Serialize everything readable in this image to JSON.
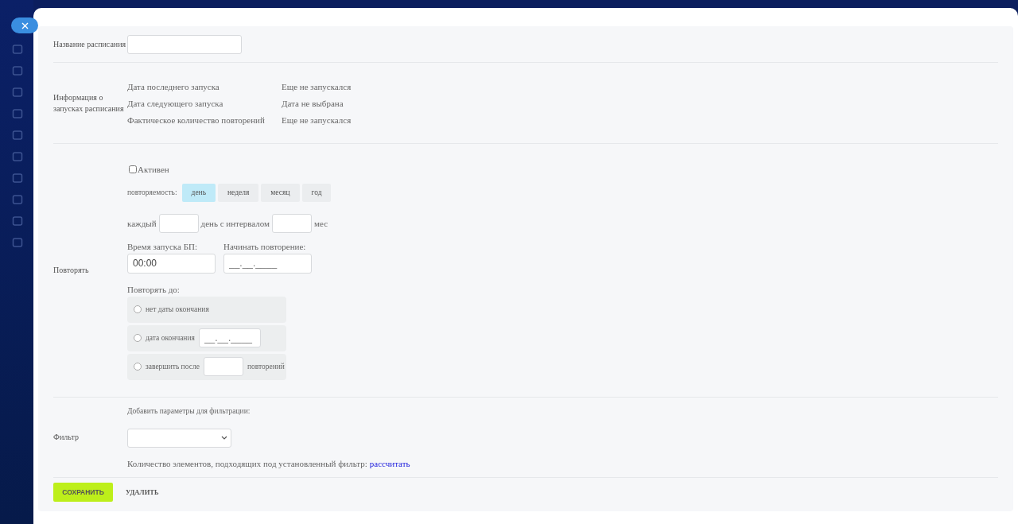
{
  "schedule_name": {
    "label": "Название расписания"
  },
  "run_info": {
    "label": "Информация о запусках расписания",
    "rows": [
      {
        "name": "Дата последнего запуска",
        "value": "Еще не запускался"
      },
      {
        "name": "Дата следующего запуска",
        "value": "Дата не выбрана"
      },
      {
        "name": "Фактическое количество повторений",
        "value": "Еще не запускался"
      }
    ]
  },
  "repeat": {
    "label": "Повторять",
    "active": {
      "label": "Активен",
      "checked": false
    },
    "frequency": {
      "label": "повторяемость:",
      "options": [
        {
          "label": "день",
          "selected": true
        },
        {
          "label": "неделя",
          "selected": false
        },
        {
          "label": "месяц",
          "selected": false
        },
        {
          "label": "год",
          "selected": false
        }
      ]
    },
    "every": {
      "prefix": "каждый",
      "middle": "день с интервалом",
      "suffix": "мес"
    },
    "start_time": {
      "label": "Время запуска БП:",
      "value": "00:00"
    },
    "start_repeat": {
      "label": "Начинать повторение:",
      "placeholder": "__.__.____"
    },
    "until": {
      "label": "Повторять до:",
      "options": [
        {
          "kind": "plain",
          "label": "нет даты окончания",
          "selected": false
        },
        {
          "kind": "date",
          "label": "дата окончания",
          "placeholder": "__.__.____",
          "selected": false
        },
        {
          "kind": "count",
          "label": "завершить после",
          "suffix": "повторений",
          "selected": false
        }
      ]
    }
  },
  "filter": {
    "label": "Фильтр",
    "hint": "Добавить параметры для фильтрации:",
    "count_text": "Количество элементов, подходящих под установленный фильтр:",
    "count_link": "рассчитать"
  },
  "buttons": {
    "save": "СОХРАНИТЬ",
    "delete": "УДАЛИТЬ"
  }
}
